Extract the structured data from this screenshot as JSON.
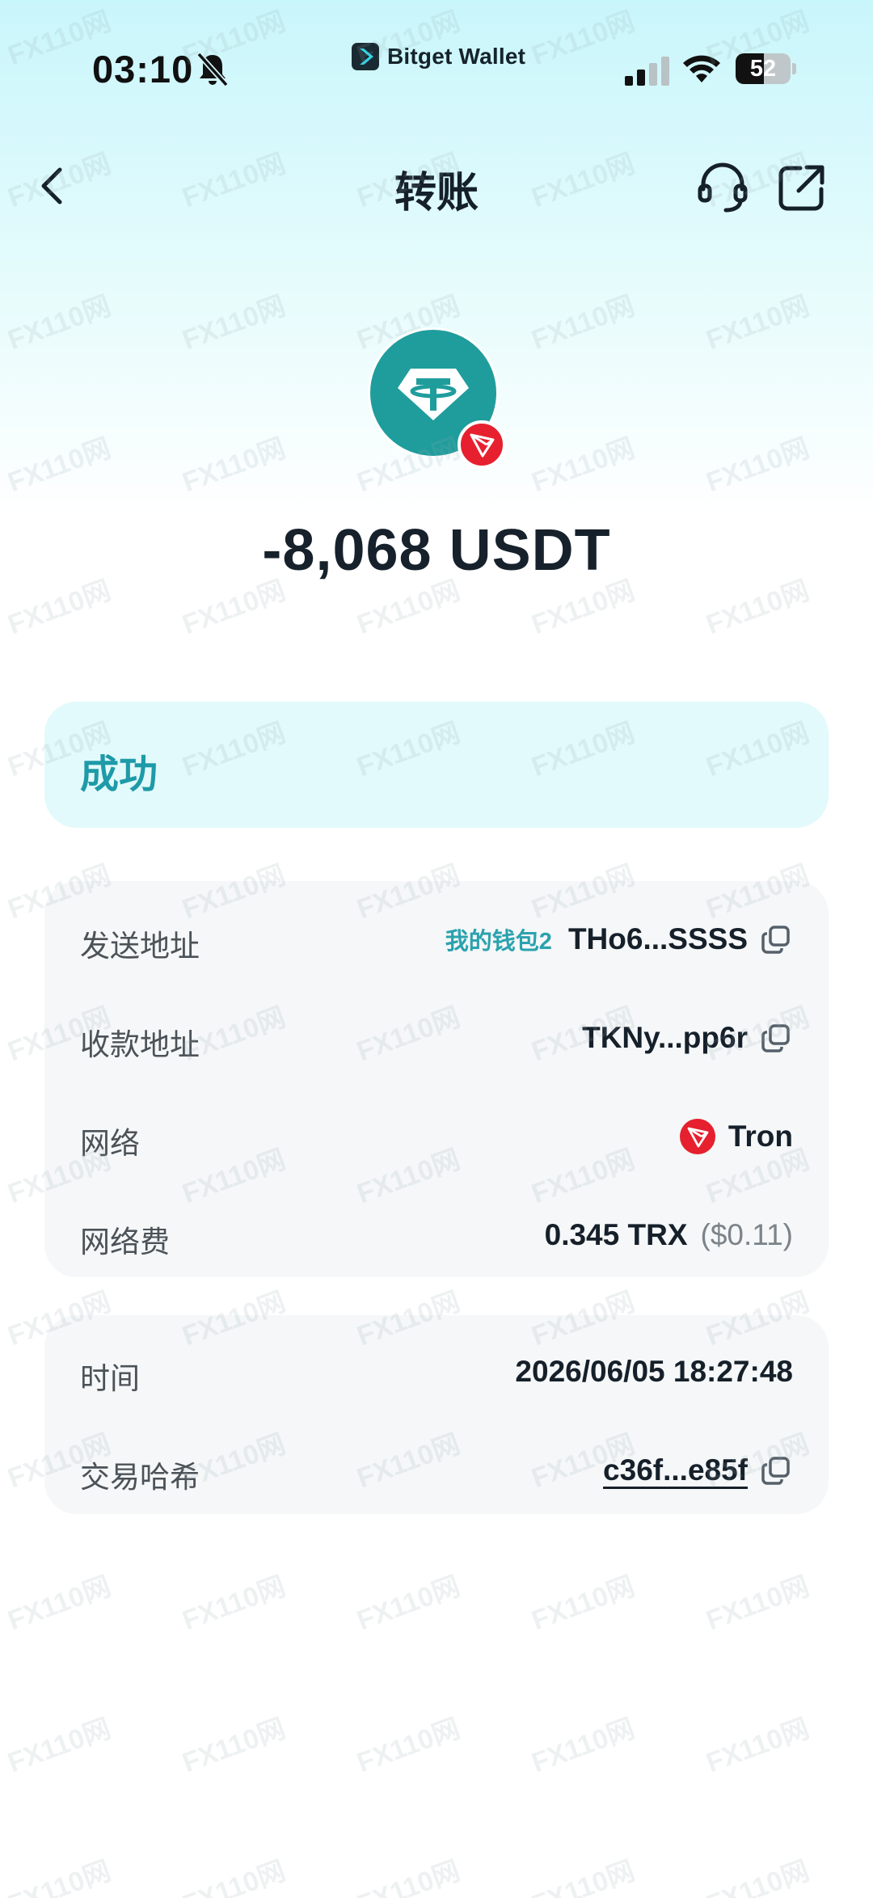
{
  "status_bar": {
    "time": "03:10",
    "brand": "Bitget Wallet",
    "battery": "52",
    "battery_level": 0.52
  },
  "header": {
    "title": "转账"
  },
  "transaction": {
    "amount": "-8,068 USDT",
    "status": "成功",
    "details": [
      {
        "label": "发送地址",
        "tag": "我的钱包2",
        "value": "THo6...SSSS",
        "copy": true
      },
      {
        "label": "收款地址",
        "value": "TKNy...pp6r",
        "copy": true
      },
      {
        "label": "网络",
        "value": "Tron",
        "icon": "tron-icon"
      },
      {
        "label": "网络费",
        "value": "0.345 TRX",
        "extra": "($0.11)"
      }
    ],
    "time_label": "时间",
    "time_value": "2026/06/05 18:27:48",
    "hash_label": "交易哈希",
    "hash_value": "c36f...e85f"
  },
  "watermark": "FX110网",
  "colors": {
    "accent": "#1e9aa8",
    "tether": "#1f9d9c",
    "tron": "#e6202e"
  }
}
